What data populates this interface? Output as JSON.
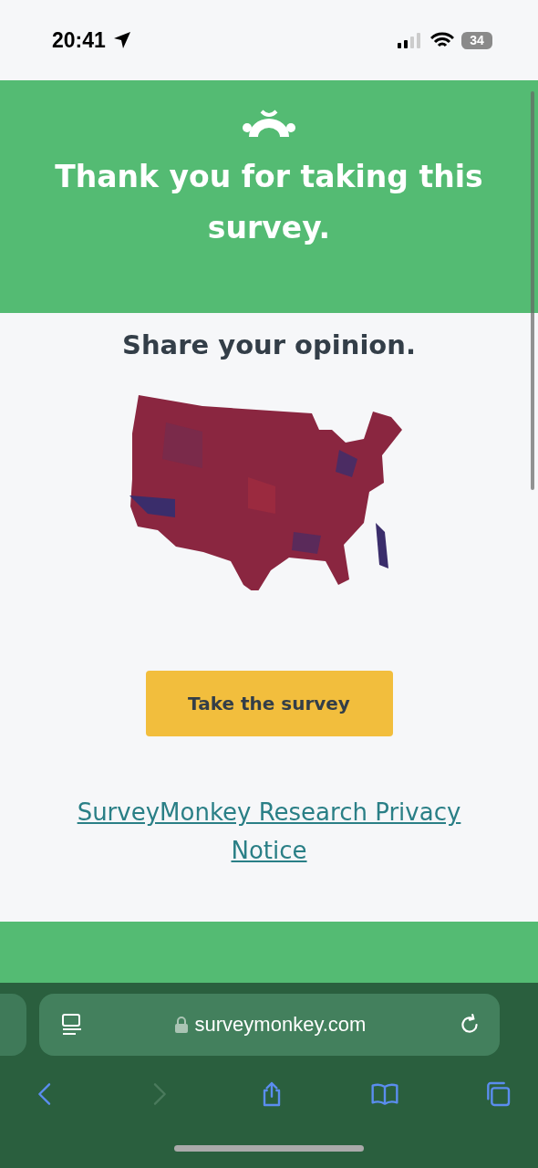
{
  "status_bar": {
    "time": "20:41",
    "battery": "34"
  },
  "banner": {
    "title": "Thank you for taking this survey."
  },
  "content": {
    "heading": "Share your opinion.",
    "button": "Take the survey",
    "privacy_link": "SurveyMonkey Research Privacy Notice"
  },
  "browser": {
    "url": "surveymonkey.com",
    "toolbar": [
      {
        "kind": "back",
        "disabled": false
      },
      {
        "kind": "forward",
        "disabled": true
      },
      {
        "kind": "share",
        "disabled": false
      },
      {
        "kind": "bookmarks",
        "disabled": false
      },
      {
        "kind": "tabs",
        "disabled": false
      }
    ]
  }
}
